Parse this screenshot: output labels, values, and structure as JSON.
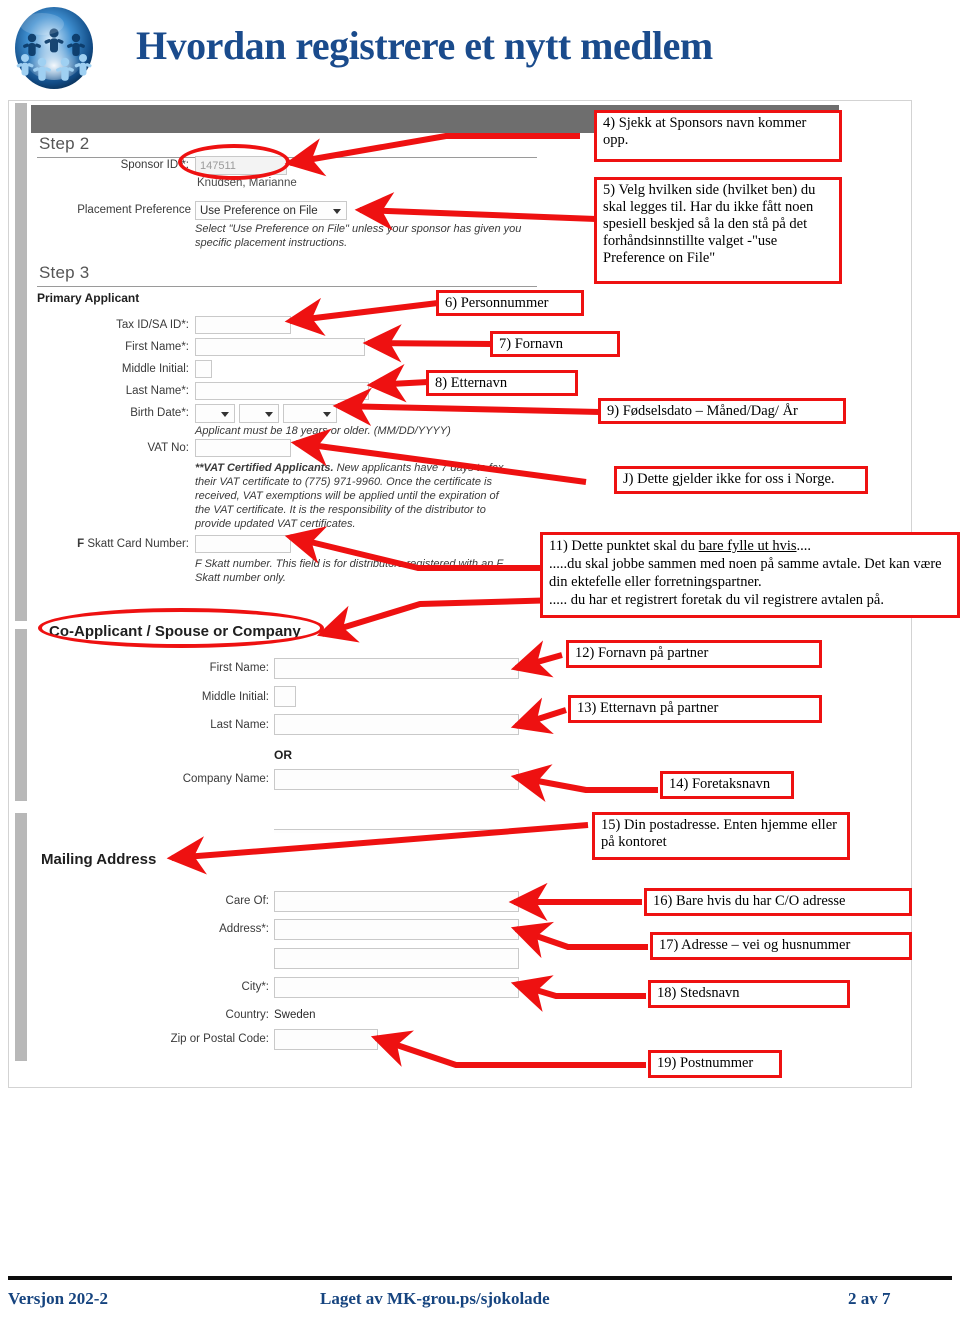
{
  "header": {
    "title": "Hvordan registrere et nytt medlem",
    "logo_icon": "people-circle-globe-logo",
    "title_color": "#1a4b8c"
  },
  "form": {
    "step2": {
      "heading": "Step 2",
      "sponsor_id_label": "Sponsor ID *:",
      "sponsor_id_value": "147511",
      "sponsor_name": "Knudsen, Marianne",
      "placement_label": "Placement Preference",
      "placement_value": "Use Preference on File",
      "placement_helper": "Select \"Use Preference on File\" unless your sponsor has given you specific placement instructions."
    },
    "step3": {
      "heading": "Step 3",
      "primary_applicant_heading": "Primary Applicant",
      "tax_id_label": "Tax ID/SA ID*:",
      "first_name_label": "First Name*:",
      "middle_initial_label": "Middle Initial:",
      "last_name_label": "Last Name*:",
      "birth_date_label": "Birth Date*:",
      "birth_date_helper": "Applicant must be 18 years or older. (MM/DD/YYYY)",
      "vat_no_label": "VAT No:",
      "vat_helper_bold": "**VAT Certified Applicants.",
      "vat_helper_rest": "New applicants have 7 days to fax their VAT certificate to (775) 971-9960. Once the certificate is received, VAT exemptions will be applied until the expiration of the VAT certificate. It is the responsibility of the distributor to provide updated VAT certificates.",
      "fskatt_label_bold": "F",
      "fskatt_label_rest": "Skatt Card Number:",
      "fskatt_helper": "F Skatt number. This field is for distributors registered with an F Skatt number only."
    },
    "coapplicant": {
      "heading": "Co-Applicant / Spouse or Company",
      "first_name_label": "First Name:",
      "middle_initial_label": "Middle Initial:",
      "last_name_label": "Last Name:",
      "or_label": "OR",
      "company_name_label": "Company Name:"
    },
    "mailing": {
      "heading": "Mailing Address",
      "care_of_label": "Care Of:",
      "address_label": "Address*:",
      "city_label": "City*:",
      "country_label": "Country:",
      "country_value": "Sweden",
      "zip_label": "Zip or Postal Code:"
    }
  },
  "annotations": {
    "accent_color": "#ee1111",
    "c4": "4) Sjekk at Sponsors navn kommer opp.",
    "c5": "5) Velg hvilken side (hvilket ben) du skal legges til. Har du ikke fått noen spesiell beskjed så la den stå på det forhåndsinnstillte valget -\"use Preference on File\"",
    "c6": "6)  Personnummer",
    "c7": "7) Fornavn",
    "c8": "8) Etternavn",
    "c9": "9)  Fødselsdato – Måned/Dag/ År",
    "cJ": "J) Dette gjelder ikke for oss i Norge.",
    "c11_line1_a": " 11) Dette punktet skal du ",
    "c11_line1_u": "bare fylle ut hvis",
    "c11_line1_b": "....",
    "c11_line2": " .....du skal jobbe sammen med noen på samme avtale. Det kan være din ektefelle eller forretningspartner.",
    "c11_line3": "..... du har  et registrert foretak  du  vil registrere avtalen på.",
    "c12": "12) Fornavn på partner",
    "c13": "13) Etternavn på partner",
    "c14": "14) Foretaksnavn",
    "c15": "15) Din postadresse. Enten hjemme eller på kontoret",
    "c16": "16) Bare hvis du har C/O adresse",
    "c17": "17) Adresse – vei og husnummer",
    "c18": "18) Stedsnavn",
    "c19": "19) Postnummer"
  },
  "footer": {
    "left": "Versjon 202-2",
    "center": "Laget av MK-grou.ps/sjokolade",
    "right": "2 av 7"
  }
}
